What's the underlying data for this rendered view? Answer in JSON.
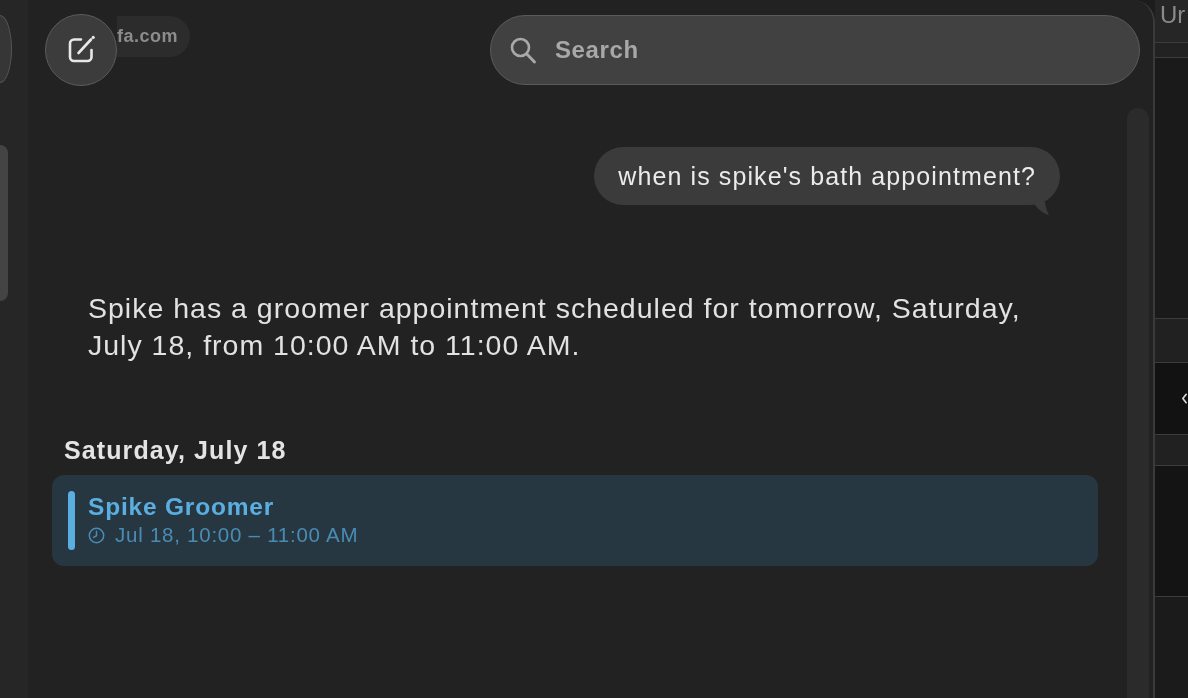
{
  "toolbar": {
    "link_chip": "fa.com",
    "search": {
      "placeholder": "Search"
    }
  },
  "conversation": {
    "question": "when is spike's bath appointment?",
    "answer": "Spike has a groomer appointment scheduled for tomorrow, Saturday, July 18, from 10:00 AM to 11:00 AM.",
    "date_heading": "Saturday, July 18",
    "events": [
      {
        "title": "Spike Groomer",
        "time": "Jul 18, 10:00 – 11:00 AM",
        "color": "#5aaee0"
      }
    ]
  },
  "background_window": {
    "title_fragment": "Ur"
  }
}
